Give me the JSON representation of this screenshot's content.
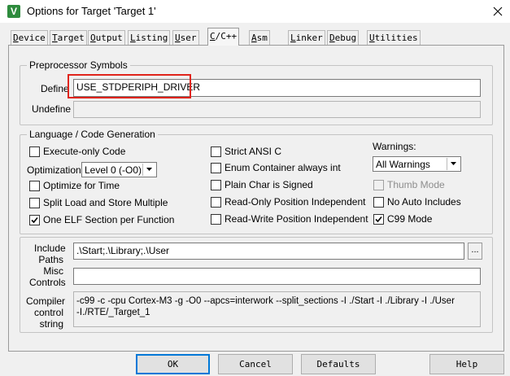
{
  "window": {
    "title": "Options for Target 'Target 1'",
    "app_icon_letter": "V",
    "app_icon_color": "#2e8b3d"
  },
  "tabs": [
    {
      "label": "Device",
      "hotkey": "D"
    },
    {
      "label": "Target",
      "hotkey": "T"
    },
    {
      "label": "Output",
      "hotkey": "O"
    },
    {
      "label": "Listing",
      "hotkey": "L"
    },
    {
      "label": "User",
      "hotkey": "U"
    },
    {
      "label": "C/C++",
      "hotkey": "C",
      "active": true
    },
    {
      "label": "Asm",
      "hotkey": "A"
    },
    {
      "label": "Linker",
      "hotkey": "L"
    },
    {
      "label": "Debug",
      "hotkey": "D"
    },
    {
      "label": "Utilities",
      "hotkey": "U"
    }
  ],
  "preprocessor": {
    "title": "Preprocessor Symbols",
    "define_label": "Define",
    "define_value": "USE_STDPERIPH_DRIVER",
    "undefine_label": "Undefine",
    "undefine_value": ""
  },
  "language": {
    "title": "Language / Code Generation",
    "execute_only": {
      "label": "Execute-only Code",
      "checked": false
    },
    "optimization_label": "Optimization:",
    "optimization_value": "Level 0 (-O0)",
    "optimize_time": {
      "label": "Optimize for Time",
      "checked": false
    },
    "split_load": {
      "label": "Split Load and Store Multiple",
      "checked": false
    },
    "one_elf": {
      "label": "One ELF Section per Function",
      "checked": true
    },
    "strict_ansi": {
      "label": "Strict ANSI C",
      "checked": false
    },
    "enum_container": {
      "label": "Enum Container always int",
      "checked": false
    },
    "plain_char": {
      "label": "Plain Char is Signed",
      "checked": false
    },
    "ro_pi": {
      "label": "Read-Only Position Independent",
      "checked": false
    },
    "rw_pi": {
      "label": "Read-Write Position Independent",
      "checked": false
    },
    "warnings_label": "Warnings:",
    "warnings_value": "All Warnings",
    "thumb_mode": {
      "label": "Thumb Mode",
      "checked": false,
      "disabled": true
    },
    "no_auto_includes": {
      "label": "No Auto Includes",
      "checked": false
    },
    "c99_mode": {
      "label": "C99 Mode",
      "checked": true
    }
  },
  "paths": {
    "include_label_1": "Include",
    "include_label_2": "Paths",
    "include_value": ".\\Start;.\\Library;.\\User",
    "browse_label": "...",
    "misc_label_1": "Misc",
    "misc_label_2": "Controls",
    "misc_value": "",
    "compiler_label_1": "Compiler",
    "compiler_label_2": "control",
    "compiler_label_3": "string",
    "compiler_line_1": "-c99 -c -cpu Cortex-M3 -g -O0 --apcs=interwork --split_sections -I ./Start -I ./Library -I ./User",
    "compiler_line_2": "-I./RTE/_Target_1"
  },
  "buttons": {
    "ok": "OK",
    "cancel": "Cancel",
    "defaults": "Defaults",
    "help": "Help"
  },
  "highlight_color": "#e0241b"
}
